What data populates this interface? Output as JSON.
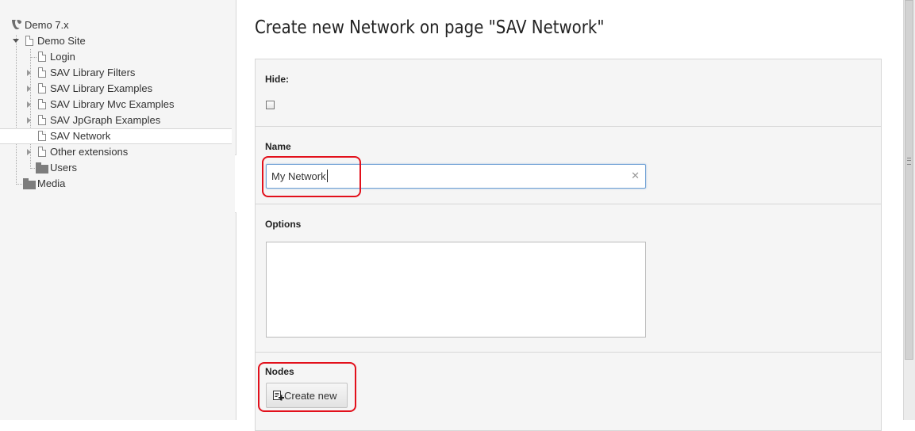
{
  "page_tree": {
    "root": {
      "label": "Demo 7.x",
      "icon": "typo3-logo-icon"
    },
    "site": {
      "label": "Demo Site",
      "icon": "page-icon"
    },
    "items": [
      {
        "label": "Login",
        "icon": "page-icon",
        "expandable": false
      },
      {
        "label": "SAV Library Filters",
        "icon": "page-icon",
        "expandable": true
      },
      {
        "label": "SAV Library Examples",
        "icon": "page-icon",
        "expandable": true
      },
      {
        "label": "SAV Library Mvc Examples",
        "icon": "page-icon",
        "expandable": true
      },
      {
        "label": "SAV JpGraph Examples",
        "icon": "page-icon",
        "expandable": true
      },
      {
        "label": "SAV Network",
        "icon": "page-icon",
        "expandable": false,
        "selected": true
      },
      {
        "label": "Other extensions",
        "icon": "page-icon",
        "expandable": true
      },
      {
        "label": "Users",
        "icon": "folder-icon",
        "expandable": false
      }
    ],
    "media": {
      "label": "Media",
      "icon": "folder-icon"
    }
  },
  "main": {
    "title": "Create new Network on page \"SAV Network\"",
    "fields": {
      "hide": {
        "label": "Hide:",
        "checked": false
      },
      "name": {
        "label": "Name",
        "value": "My Network"
      },
      "options": {
        "label": "Options",
        "value": ""
      },
      "nodes": {
        "label": "Nodes",
        "button_label": "Create new"
      }
    }
  },
  "colors": {
    "highlight": "#e2101b",
    "tree_background": "#f5f5f5",
    "form_background": "#f5f5f5",
    "input_focus_border": "#6ea0d4"
  }
}
